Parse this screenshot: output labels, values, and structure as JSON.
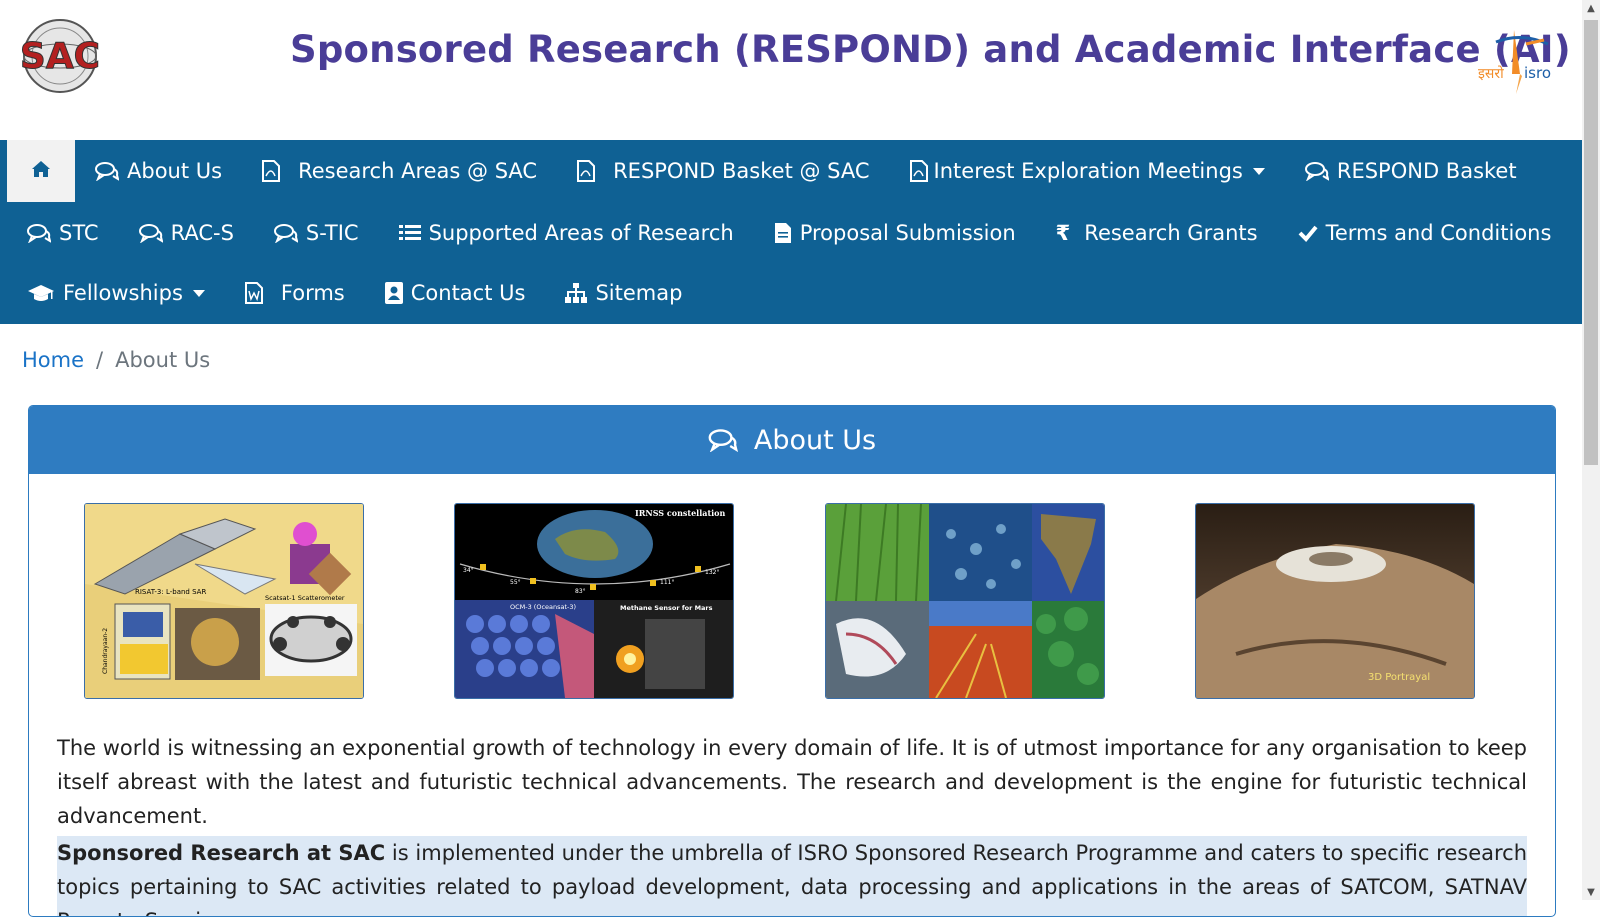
{
  "header": {
    "title": "Sponsored Research (RESPOND) and Academic Interface (AI)",
    "left_logo_text": "SAC",
    "right_logo_text_hindi": "इसरो",
    "right_logo_text": "isro"
  },
  "nav": {
    "home_icon": "home-icon",
    "row1": [
      {
        "label": "About Us",
        "icon": "comments-icon"
      },
      {
        "label": "Research Areas @ SAC",
        "icon": "pdf-file-icon"
      },
      {
        "label": "RESPOND Basket @ SAC",
        "icon": "pdf-file-icon"
      },
      {
        "label": "Interest Exploration Meetings",
        "icon": "pdf-file-icon",
        "dropdown": true
      },
      {
        "label": "RESPOND Basket",
        "icon": "comments-icon"
      }
    ],
    "row2": [
      {
        "label": "STC",
        "icon": "comments-icon"
      },
      {
        "label": "RAC-S",
        "icon": "comments-icon"
      },
      {
        "label": "S-TIC",
        "icon": "comments-icon"
      },
      {
        "label": "Supported Areas of Research",
        "icon": "list-icon"
      },
      {
        "label": "Proposal Submission",
        "icon": "document-icon"
      },
      {
        "label": "Research Grants",
        "icon": "rupee-icon",
        "glyph": "₹"
      },
      {
        "label": "Terms and Conditions",
        "icon": "check-icon"
      }
    ],
    "row3": [
      {
        "label": "Fellowships",
        "icon": "graduation-cap-icon",
        "dropdown": true
      },
      {
        "label": "Forms",
        "icon": "word-file-icon"
      },
      {
        "label": "Contact Us",
        "icon": "contact-card-icon"
      },
      {
        "label": "Sitemap",
        "icon": "sitemap-icon"
      }
    ]
  },
  "breadcrumb": {
    "home": "Home",
    "separator": "/",
    "current": "About Us"
  },
  "card": {
    "title": "About Us",
    "images": [
      {
        "name": "sac-payloads-image",
        "labels": [
          "RISAT-3: L-band SAR",
          "Scatsat-1 Scatterometer",
          "Chandrayaan-2"
        ]
      },
      {
        "name": "irnss-constellation-image",
        "labels": [
          "IRNSS constellation",
          "OCM-3 (Oceansat-3)",
          "Methane Sensor for Mars",
          "34°",
          "55°",
          "83°",
          "111°",
          "132°"
        ]
      },
      {
        "name": "remote-sensing-mosaic-image",
        "labels": []
      },
      {
        "name": "mars-3d-portrayal-image",
        "labels": [
          "3D Portrayal"
        ]
      }
    ],
    "paragraph1": "The world is witnessing an exponential growth of technology in every domain of life. It is of utmost importance for any organisation to keep itself abreast with the latest and futuristic technical advancements. The research and development is the engine for futuristic technical advancement.",
    "paragraph2_bold": "Sponsored Research at SAC",
    "paragraph2_rest": " is implemented under the umbrella of ISRO Sponsored Research Programme and caters to specific research topics pertaining to SAC activities related to payload development, data processing and applications in the areas of SATCOM, SATNAV Remote Sensing,"
  },
  "colors": {
    "navbar": "#0f6194",
    "title": "#4a3d97",
    "card_header": "#2f7cc1",
    "link": "#1a73c7",
    "highlight": "#dce8f5"
  }
}
